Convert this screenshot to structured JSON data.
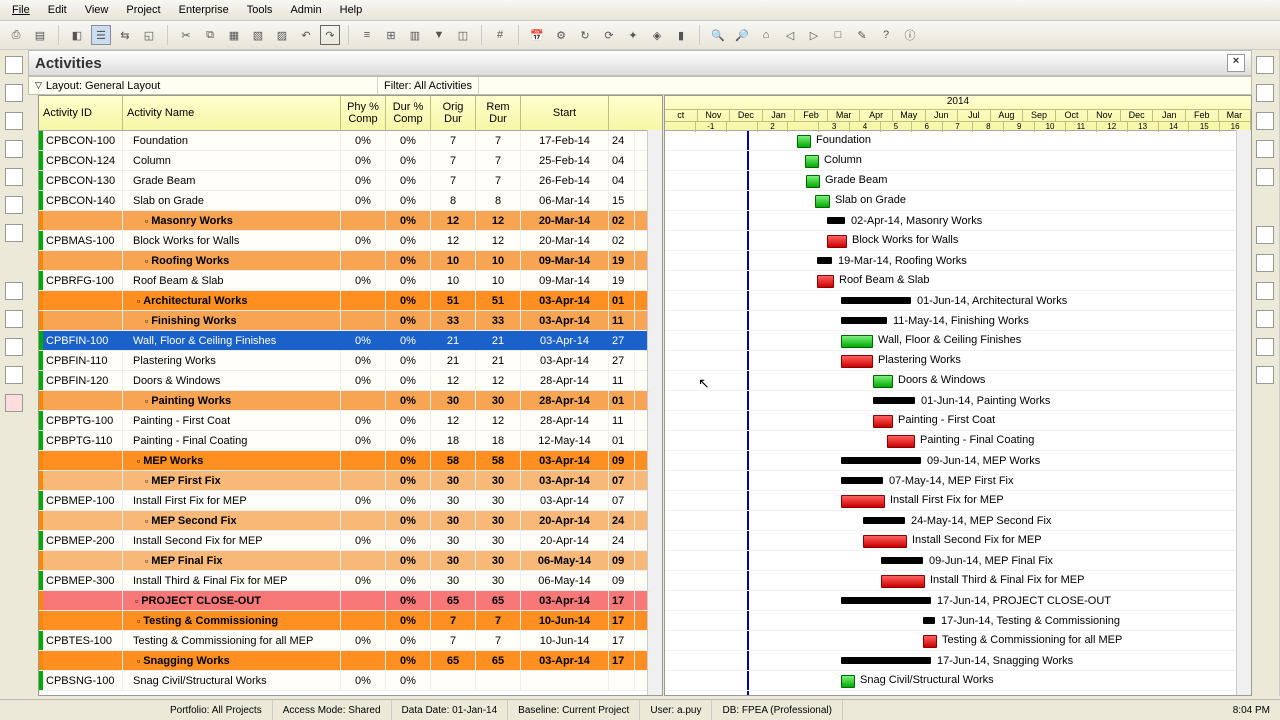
{
  "menu": [
    "File",
    "Edit",
    "View",
    "Project",
    "Enterprise",
    "Tools",
    "Admin",
    "Help"
  ],
  "panel_title": "Activities",
  "layout_label": "Layout: General Layout",
  "filter_label": "Filter: All Activities",
  "columns": {
    "id": "Activity ID",
    "name": "Activity Name",
    "phy": "Phy % Comp",
    "dur": "Dur % Comp",
    "orig": "Orig Dur",
    "rem": "Rem Dur",
    "start": "Start",
    "fin": ""
  },
  "timescale": {
    "year": "2014",
    "months": [
      "ct",
      "Nov",
      "Dec",
      "Jan",
      "Feb",
      "Mar",
      "Apr",
      "May",
      "Jun",
      "Jul",
      "Aug",
      "Sep",
      "Oct",
      "Nov",
      "Dec",
      "Jan",
      "Feb",
      "Mar"
    ],
    "weeks": [
      "",
      "-1",
      "",
      "2",
      "",
      "3",
      "4",
      "5",
      "6",
      "7",
      "8",
      "9",
      "10",
      "11",
      "12",
      "13",
      "14",
      "15",
      "16"
    ]
  },
  "rows": [
    {
      "t": "task",
      "id": "CPBCON-100",
      "name": "Foundation",
      "phy": "0%",
      "dur": "0%",
      "od": "7",
      "rd": "7",
      "st": "17-Feb-14",
      "fi": "24",
      "bx": 132,
      "bw": 12,
      "bt": "green",
      "bl": "Foundation"
    },
    {
      "t": "task",
      "id": "CPBCON-124",
      "name": "Column",
      "phy": "0%",
      "dur": "0%",
      "od": "7",
      "rd": "7",
      "st": "25-Feb-14",
      "fi": "04",
      "bx": 140,
      "bw": 12,
      "bt": "green",
      "bl": "Column"
    },
    {
      "t": "task",
      "id": "CPBCON-130",
      "name": "Grade Beam",
      "phy": "0%",
      "dur": "0%",
      "od": "7",
      "rd": "7",
      "st": "26-Feb-14",
      "fi": "04",
      "bx": 141,
      "bw": 12,
      "bt": "green",
      "bl": "Grade Beam"
    },
    {
      "t": "task",
      "id": "CPBCON-140",
      "name": "Slab on Grade",
      "phy": "0%",
      "dur": "0%",
      "od": "8",
      "rd": "8",
      "st": "06-Mar-14",
      "fi": "15",
      "bx": 150,
      "bw": 13,
      "bt": "green",
      "bl": "Slab on Grade"
    },
    {
      "t": "wbs3",
      "id": "",
      "name": "Masonry Works",
      "phy": "",
      "dur": "0%",
      "od": "12",
      "rd": "12",
      "st": "20-Mar-14",
      "fi": "02",
      "bx": 162,
      "bw": 18,
      "bt": "sum",
      "bl": "02-Apr-14, Masonry Works"
    },
    {
      "t": "task",
      "id": "CPBMAS-100",
      "name": "Block Works for Walls",
      "phy": "0%",
      "dur": "0%",
      "od": "12",
      "rd": "12",
      "st": "20-Mar-14",
      "fi": "02",
      "bx": 162,
      "bw": 18,
      "bt": "red",
      "bl": "Block Works for Walls"
    },
    {
      "t": "wbs3",
      "id": "",
      "name": "Roofing Works",
      "phy": "",
      "dur": "0%",
      "od": "10",
      "rd": "10",
      "st": "09-Mar-14",
      "fi": "19",
      "bx": 152,
      "bw": 15,
      "bt": "sum",
      "bl": "19-Mar-14, Roofing Works"
    },
    {
      "t": "task",
      "id": "CPBRFG-100",
      "name": "Roof Beam & Slab",
      "phy": "0%",
      "dur": "0%",
      "od": "10",
      "rd": "10",
      "st": "09-Mar-14",
      "fi": "19",
      "bx": 152,
      "bw": 15,
      "bt": "red",
      "bl": "Roof Beam & Slab"
    },
    {
      "t": "wbs2",
      "id": "",
      "name": "Architectural Works",
      "phy": "",
      "dur": "0%",
      "od": "51",
      "rd": "51",
      "st": "03-Apr-14",
      "fi": "01",
      "bx": 176,
      "bw": 70,
      "bt": "sum",
      "bl": "01-Jun-14, Architectural Works"
    },
    {
      "t": "wbs3",
      "id": "",
      "name": "Finishing Works",
      "phy": "",
      "dur": "0%",
      "od": "33",
      "rd": "33",
      "st": "03-Apr-14",
      "fi": "11",
      "bx": 176,
      "bw": 46,
      "bt": "sum",
      "bl": "11-May-14, Finishing Works"
    },
    {
      "t": "sel",
      "id": "CPBFIN-100",
      "name": "Wall, Floor & Ceiling Finishes",
      "phy": "0%",
      "dur": "0%",
      "od": "21",
      "rd": "21",
      "st": "03-Apr-14",
      "fi": "27",
      "bx": 176,
      "bw": 30,
      "bt": "green",
      "bl": "Wall, Floor & Ceiling Finishes"
    },
    {
      "t": "task",
      "id": "CPBFIN-110",
      "name": "Plastering Works",
      "phy": "0%",
      "dur": "0%",
      "od": "21",
      "rd": "21",
      "st": "03-Apr-14",
      "fi": "27",
      "bx": 176,
      "bw": 30,
      "bt": "red",
      "bl": "Plastering Works"
    },
    {
      "t": "task",
      "id": "CPBFIN-120",
      "name": "Doors & Windows",
      "phy": "0%",
      "dur": "0%",
      "od": "12",
      "rd": "12",
      "st": "28-Apr-14",
      "fi": "11",
      "bx": 208,
      "bw": 18,
      "bt": "green",
      "bl": "Doors & Windows"
    },
    {
      "t": "wbs3",
      "id": "",
      "name": "Painting Works",
      "phy": "",
      "dur": "0%",
      "od": "30",
      "rd": "30",
      "st": "28-Apr-14",
      "fi": "01",
      "bx": 208,
      "bw": 42,
      "bt": "sum",
      "bl": "01-Jun-14, Painting Works"
    },
    {
      "t": "task",
      "id": "CPBPTG-100",
      "name": "Painting - First Coat",
      "phy": "0%",
      "dur": "0%",
      "od": "12",
      "rd": "12",
      "st": "28-Apr-14",
      "fi": "11",
      "bx": 208,
      "bw": 18,
      "bt": "red",
      "bl": "Painting - First Coat"
    },
    {
      "t": "task",
      "id": "CPBPTG-110",
      "name": "Painting - Final Coating",
      "phy": "0%",
      "dur": "0%",
      "od": "18",
      "rd": "18",
      "st": "12-May-14",
      "fi": "01",
      "bx": 222,
      "bw": 26,
      "bt": "red",
      "bl": "Painting - Final Coating"
    },
    {
      "t": "wbs2",
      "id": "",
      "name": "MEP Works",
      "phy": "",
      "dur": "0%",
      "od": "58",
      "rd": "58",
      "st": "03-Apr-14",
      "fi": "09",
      "bx": 176,
      "bw": 80,
      "bt": "sum",
      "bl": "09-Jun-14, MEP Works"
    },
    {
      "t": "wbs4",
      "id": "",
      "name": "MEP First Fix",
      "phy": "",
      "dur": "0%",
      "od": "30",
      "rd": "30",
      "st": "03-Apr-14",
      "fi": "07",
      "bx": 176,
      "bw": 42,
      "bt": "sum",
      "bl": "07-May-14, MEP First Fix"
    },
    {
      "t": "task",
      "id": "CPBMEP-100",
      "name": "Install First Fix for MEP",
      "phy": "0%",
      "dur": "0%",
      "od": "30",
      "rd": "30",
      "st": "03-Apr-14",
      "fi": "07",
      "bx": 176,
      "bw": 42,
      "bt": "red",
      "bl": "Install First Fix for MEP"
    },
    {
      "t": "wbs4",
      "id": "",
      "name": "MEP Second Fix",
      "phy": "",
      "dur": "0%",
      "od": "30",
      "rd": "30",
      "st": "20-Apr-14",
      "fi": "24",
      "bx": 198,
      "bw": 42,
      "bt": "sum",
      "bl": "24-May-14, MEP Second Fix"
    },
    {
      "t": "task",
      "id": "CPBMEP-200",
      "name": "Install Second Fix for MEP",
      "phy": "0%",
      "dur": "0%",
      "od": "30",
      "rd": "30",
      "st": "20-Apr-14",
      "fi": "24",
      "bx": 198,
      "bw": 42,
      "bt": "red",
      "bl": "Install Second Fix for MEP"
    },
    {
      "t": "wbs4",
      "id": "",
      "name": "MEP Final Fix",
      "phy": "",
      "dur": "0%",
      "od": "30",
      "rd": "30",
      "st": "06-May-14",
      "fi": "09",
      "bx": 216,
      "bw": 42,
      "bt": "sum",
      "bl": "09-Jun-14, MEP Final Fix"
    },
    {
      "t": "task",
      "id": "CPBMEP-300",
      "name": "Install Third & Final Fix for MEP",
      "phy": "0%",
      "dur": "0%",
      "od": "30",
      "rd": "30",
      "st": "06-May-14",
      "fi": "09",
      "bx": 216,
      "bw": 42,
      "bt": "red",
      "bl": "Install Third & Final Fix for MEP"
    },
    {
      "t": "wbs5",
      "id": "",
      "name": "PROJECT CLOSE-OUT",
      "phy": "",
      "dur": "0%",
      "od": "65",
      "rd": "65",
      "st": "03-Apr-14",
      "fi": "17",
      "bx": 176,
      "bw": 90,
      "bt": "sum",
      "bl": "17-Jun-14, PROJECT CLOSE-OUT"
    },
    {
      "t": "wbs2",
      "id": "",
      "name": "Testing & Commissioning",
      "phy": "",
      "dur": "0%",
      "od": "7",
      "rd": "7",
      "st": "10-Jun-14",
      "fi": "17",
      "bx": 258,
      "bw": 12,
      "bt": "sum",
      "bl": "17-Jun-14, Testing & Commissioning"
    },
    {
      "t": "task",
      "id": "CPBTES-100",
      "name": "Testing & Commissioning for all MEP",
      "phy": "0%",
      "dur": "0%",
      "od": "7",
      "rd": "7",
      "st": "10-Jun-14",
      "fi": "17",
      "bx": 258,
      "bw": 12,
      "bt": "red",
      "bl": "Testing & Commissioning for all MEP"
    },
    {
      "t": "wbs2",
      "id": "",
      "name": "Snagging Works",
      "phy": "",
      "dur": "0%",
      "od": "65",
      "rd": "65",
      "st": "03-Apr-14",
      "fi": "17",
      "bx": 176,
      "bw": 90,
      "bt": "sum",
      "bl": "17-Jun-14, Snagging Works"
    },
    {
      "t": "task",
      "id": "CPBSNG-100",
      "name": "Snag Civil/Structural Works",
      "phy": "0%",
      "dur": "0%",
      "od": "",
      "rd": "",
      "st": "",
      "fi": "",
      "bx": 176,
      "bw": 12,
      "bt": "green",
      "bl": "Snag Civil/Structural Works"
    }
  ],
  "status": {
    "portfolio": "Portfolio: All Projects",
    "access": "Access Mode: Shared",
    "datadate": "Data Date: 01-Jan-14",
    "baseline": "Baseline: Current Project",
    "user": "User: a.puy",
    "db": "DB: FPEA (Professional)",
    "time": "8:04 PM"
  }
}
